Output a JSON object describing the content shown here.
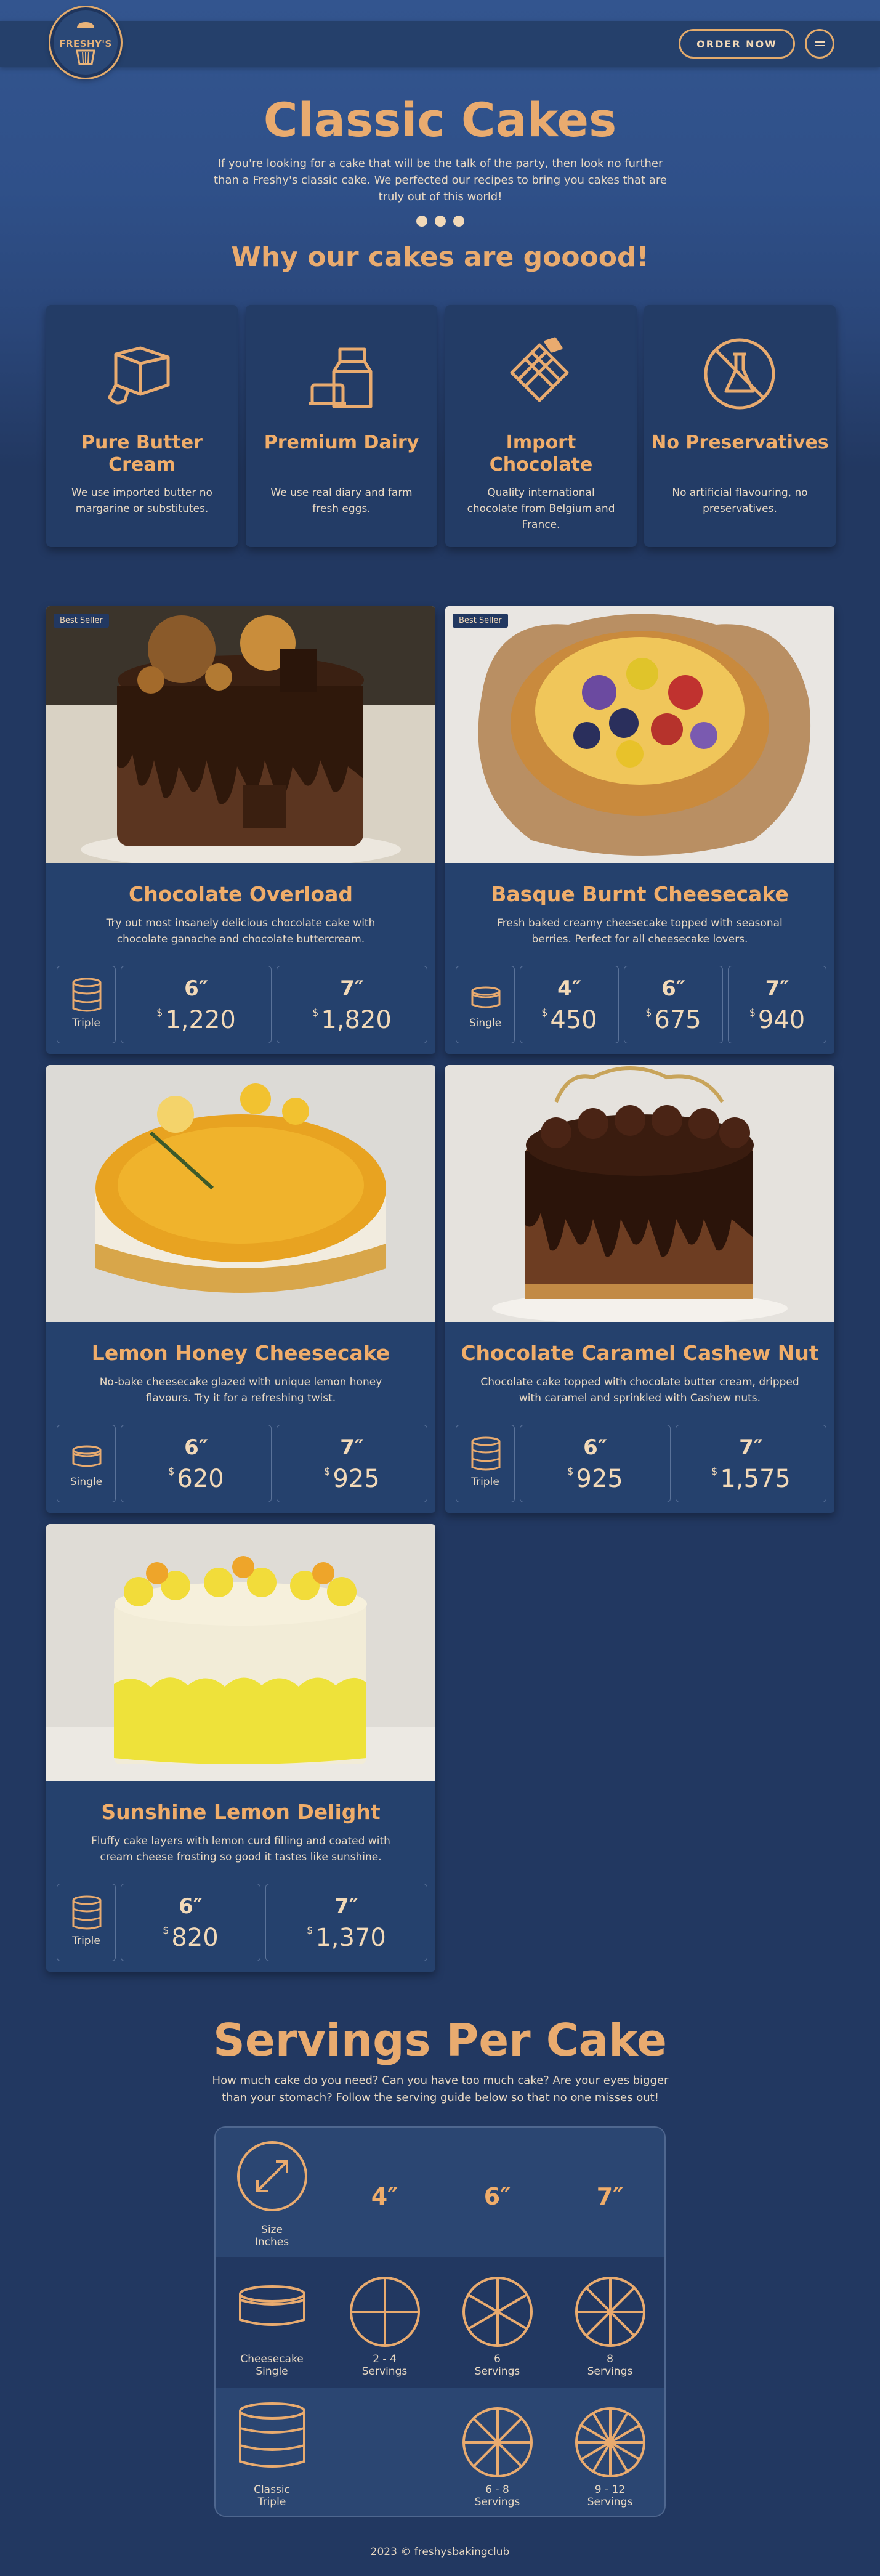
{
  "nav": {
    "logo_text": "FRESHY'S",
    "order_label": "ORDER NOW"
  },
  "hero": {
    "title": "Classic Cakes",
    "description": "If you're looking for a cake that will be the talk of the party, then look no further than a Freshy's classic cake. We perfected our recipes to bring you cakes that are truly out of this world!",
    "why_title": "Why our cakes are gooood!"
  },
  "features": [
    {
      "icon": "butter-icon",
      "title": "Pure Butter Cream",
      "desc": "We use imported butter no margarine or substitutes."
    },
    {
      "icon": "milk-icon",
      "title": "Premium Dairy",
      "desc": "We use real diary and farm fresh eggs."
    },
    {
      "icon": "chocolate-icon",
      "title": "Import Chocolate",
      "desc": "Quality international chocolate from Belgium and France."
    },
    {
      "icon": "no-preservatives-icon",
      "title": "No Preservatives",
      "desc": "No artificial flavouring, no preservatives."
    }
  ],
  "cakes": [
    {
      "badge": "Best Seller",
      "title": "Chocolate Overload",
      "desc": "Try out most insanely delicious chocolate cake with chocolate ganache and chocolate buttercream.",
      "type": "Triple",
      "options": [
        {
          "size": "6″",
          "currency": "$",
          "price": "1,220"
        },
        {
          "size": "7″",
          "currency": "$",
          "price": "1,820"
        }
      ]
    },
    {
      "badge": "Best Seller",
      "title": "Basque Burnt Cheesecake",
      "desc": "Fresh baked creamy cheesecake topped with seasonal berries. Perfect for all cheesecake lovers.",
      "type": "Single",
      "options": [
        {
          "size": "4″",
          "currency": "$",
          "price": "450"
        },
        {
          "size": "6″",
          "currency": "$",
          "price": "675"
        },
        {
          "size": "7″",
          "currency": "$",
          "price": "940"
        }
      ]
    },
    {
      "title": "Lemon Honey Cheesecake",
      "desc": "No-bake cheesecake glazed with unique lemon honey flavours. Try it for a refreshing twist.",
      "type": "Single",
      "options": [
        {
          "size": "6″",
          "currency": "$",
          "price": "620"
        },
        {
          "size": "7″",
          "currency": "$",
          "price": "925"
        }
      ]
    },
    {
      "title": "Chocolate Caramel Cashew Nut",
      "desc": "Chocolate cake topped with chocolate butter cream, dripped with caramel and sprinkled with Cashew nuts.",
      "type": "Triple",
      "options": [
        {
          "size": "6″",
          "currency": "$",
          "price": "925"
        },
        {
          "size": "7″",
          "currency": "$",
          "price": "1,575"
        }
      ]
    },
    {
      "title": "Sunshine Lemon Delight",
      "desc": "Fluffy cake layers with lemon curd filling and coated with cream cheese frosting so good it tastes like sunshine.",
      "type": "Triple",
      "options": [
        {
          "size": "6″",
          "currency": "$",
          "price": "820"
        },
        {
          "size": "7″",
          "currency": "$",
          "price": "1,370"
        }
      ]
    }
  ],
  "servings": {
    "title": "Servings Per Cake",
    "description": "How much cake do you need? Can you have too much cake? Are your eyes bigger than your stomach? Follow the serving guide below so that no one misses out!",
    "header_label_1": "Size",
    "header_label_2": "Inches",
    "sizes": [
      "4″",
      "6″",
      "7″"
    ],
    "rows": [
      {
        "label_1": "Cheesecake",
        "label_2": "Single",
        "cells": [
          {
            "l1": "2 - 4",
            "l2": "Servings"
          },
          {
            "l1": "6",
            "l2": "Servings"
          },
          {
            "l1": "8",
            "l2": "Servings"
          }
        ]
      },
      {
        "label_1": "Classic",
        "label_2": "Triple",
        "cells": [
          null,
          {
            "l1": "6 - 8",
            "l2": "Servings"
          },
          {
            "l1": "9 - 12",
            "l2": "Servings"
          }
        ]
      }
    ]
  },
  "footer": "2023 © freshysbakingclub",
  "colors": {
    "accent": "#e9ab6f",
    "background": "#223861",
    "card": "#25416d"
  }
}
